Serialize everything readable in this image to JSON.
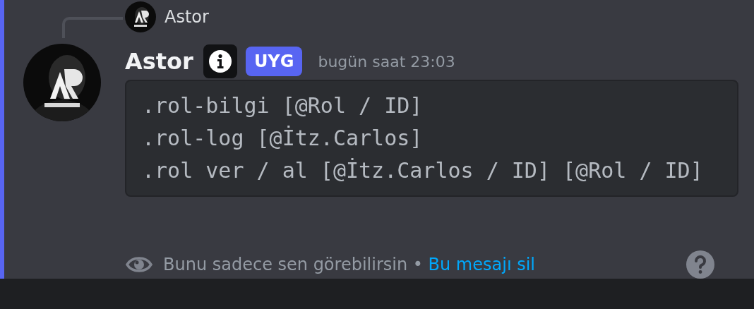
{
  "reply": {
    "username": "Astor"
  },
  "message": {
    "username": "Astor",
    "tag": "UYG",
    "timestamp": "bugün saat 23:03",
    "code_lines": [
      ".rol-bilgi [@Rol / ID]",
      ".rol-log [@İtz.Carlos]",
      ".rol ver / al [@İtz.Carlos / ID] [@Rol / ID]"
    ]
  },
  "ephemeral": {
    "notice": "Bunu sadece sen görebilirsin",
    "separator": "•",
    "link": "Bu mesajı sil"
  }
}
